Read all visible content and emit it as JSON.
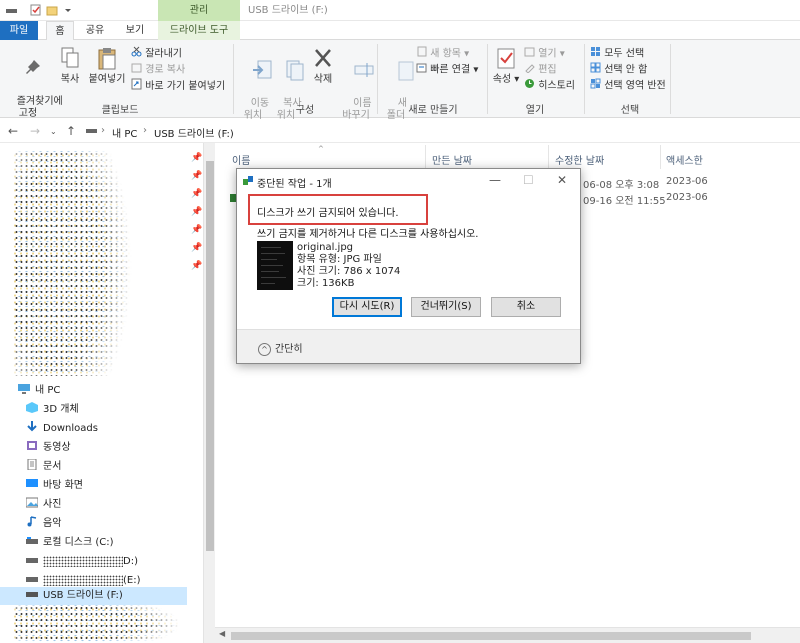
{
  "title_bar": {
    "manage_tab": "관리",
    "window_title": "USB 드라이브 (F:)"
  },
  "tabs": {
    "file": "파일",
    "home": "홈",
    "share": "공유",
    "view": "보기",
    "drive_tools": "드라이브 도구"
  },
  "ribbon": {
    "clipboard": {
      "pin": "즐겨찾기에\n고정",
      "copy": "복사",
      "paste": "붙여넣기",
      "cut": "잘라내기",
      "copy_path": "경로 복사",
      "paste_shortcut": "바로 가기 붙여넣기",
      "label": "클립보드"
    },
    "organize": {
      "move_to": "이동\n위치",
      "copy_to": "복사\n위치",
      "delete": "삭제",
      "rename": "이름\n바꾸기",
      "label": "구성"
    },
    "new": {
      "new_folder": "새\n폴더",
      "new_item": "새 항목",
      "easy_access": "빠른 연결",
      "label": "새로 만들기"
    },
    "open": {
      "properties": "속성",
      "open": "열기",
      "edit": "편집",
      "history": "히스토리",
      "label": "열기"
    },
    "select": {
      "select_all": "모두 선택",
      "select_none": "선택 안 함",
      "invert": "선택 영역 반전",
      "label": "선택"
    }
  },
  "address": {
    "crumb1": "내 PC",
    "crumb2": "USB 드라이브 (F:)"
  },
  "nav": {
    "this_pc": "내 PC",
    "items": [
      {
        "label": "3D 개체",
        "icon": "cube-icon"
      },
      {
        "label": "Downloads",
        "icon": "download-icon"
      },
      {
        "label": "동영상",
        "icon": "video-icon"
      },
      {
        "label": "문서",
        "icon": "document-icon"
      },
      {
        "label": "바탕 화면",
        "icon": "desktop-icon"
      },
      {
        "label": "사진",
        "icon": "picture-icon"
      },
      {
        "label": "음악",
        "icon": "music-icon"
      },
      {
        "label": "로컬 디스크 (C:)",
        "icon": "drive-icon"
      },
      {
        "label": "D:)",
        "icon": "drive-icon"
      },
      {
        "label": "(E:)",
        "icon": "drive-icon"
      },
      {
        "label": "USB 드라이브 (F:)",
        "icon": "usb-drive-icon"
      }
    ]
  },
  "columns": {
    "name": "이름",
    "created": "만든 날짜",
    "modified": "수정한 날짜",
    "accessed": "액세스한"
  },
  "rows": [
    {
      "modified": "06-08 오후 3:08",
      "accessed": "2023-06"
    },
    {
      "modified": "09-16 오전 11:55",
      "accessed": "2023-06"
    }
  ],
  "dialog": {
    "title": "중단된 작업 - 1개",
    "message": "디스크가 쓰기 금지되어 있습니다.",
    "sub": "쓰기 금지를 제거하거나 다른 디스크를 사용하십시오.",
    "file_name": "original.jpg",
    "file_type": "항목 유형: JPG 파일",
    "dimensions": "사진 크기: 786 x 1074",
    "size": "크기: 136KB",
    "retry": "다시 시도(R)",
    "skip": "건너뛰기(S)",
    "cancel": "취소",
    "fewer_details": "간단히"
  }
}
